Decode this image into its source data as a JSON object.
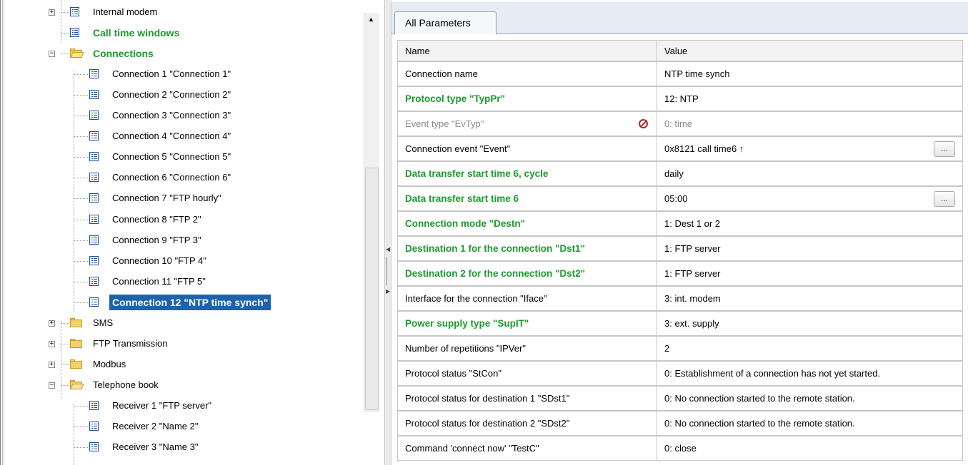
{
  "tree": {
    "items": [
      {
        "label": "Internal modem",
        "style": "normal",
        "icon": "list-icon",
        "expander": "+"
      },
      {
        "label": "Call time windows",
        "style": "green",
        "icon": "list-icon",
        "expander": ""
      },
      {
        "label": "Connections",
        "style": "green",
        "icon": "folder-open-icon",
        "expander": "−"
      },
      {
        "label": "Connection 1 \"Connection 1\"",
        "style": "normal",
        "icon": "list-icon"
      },
      {
        "label": "Connection 2 \"Connection 2\"",
        "style": "normal",
        "icon": "list-icon"
      },
      {
        "label": "Connection 3 \"Connection 3\"",
        "style": "normal",
        "icon": "list-icon"
      },
      {
        "label": "Connection 4 \"Connection 4\"",
        "style": "normal",
        "icon": "list-icon"
      },
      {
        "label": "Connection 5 \"Connection 5\"",
        "style": "normal",
        "icon": "list-icon"
      },
      {
        "label": "Connection 6 \"Connection 6\"",
        "style": "normal",
        "icon": "list-icon"
      },
      {
        "label": "Connection 7 \"FTP hourly\"",
        "style": "normal",
        "icon": "list-icon"
      },
      {
        "label": "Connection 8 \"FTP 2\"",
        "style": "normal",
        "icon": "list-icon"
      },
      {
        "label": "Connection 9 \"FTP 3\"",
        "style": "normal",
        "icon": "list-icon"
      },
      {
        "label": "Connection 10 \"FTP 4\"",
        "style": "normal",
        "icon": "list-icon"
      },
      {
        "label": "Connection 11 \"FTP 5\"",
        "style": "normal",
        "icon": "list-icon"
      },
      {
        "label": "Connection 12 \"NTP time synch\"",
        "style": "selected",
        "icon": "list-icon"
      },
      {
        "label": "SMS",
        "style": "normal",
        "icon": "folder-icon",
        "expander": "+"
      },
      {
        "label": "FTP Transmission",
        "style": "normal",
        "icon": "folder-icon",
        "expander": "+"
      },
      {
        "label": "Modbus",
        "style": "normal",
        "icon": "folder-icon",
        "expander": "+"
      },
      {
        "label": "Telephone book",
        "style": "normal",
        "icon": "folder-open-icon",
        "expander": "−"
      },
      {
        "label": "Receiver 1 \"FTP server\"",
        "style": "normal",
        "icon": "list-icon"
      },
      {
        "label": "Receiver 2 \"Name 2\"",
        "style": "normal",
        "icon": "list-icon"
      },
      {
        "label": "Receiver 3 \"Name 3\"",
        "style": "normal",
        "icon": "list-icon"
      }
    ]
  },
  "tabs": [
    {
      "label": "All Parameters",
      "active": true
    }
  ],
  "grid": {
    "columns": [
      "Name",
      "Value"
    ],
    "rows": [
      {
        "name": "Connection name",
        "value": "NTP time synch",
        "style": "normal"
      },
      {
        "name": "Protocol type \"TypPr\"",
        "value": "12: NTP",
        "style": "green"
      },
      {
        "name": "Event type \"EvTyp\"",
        "value": "0: time",
        "style": "grey",
        "name_icon": "no-entry-icon"
      },
      {
        "name": "Connection event \"Event\"",
        "value": "0x8121 call time6 ↑",
        "style": "normal",
        "button": "..."
      },
      {
        "name": "Data transfer start time 6, cycle",
        "value": "daily",
        "style": "green"
      },
      {
        "name": "Data transfer start time 6",
        "value": "05:00",
        "style": "green",
        "button": "..."
      },
      {
        "name": "Connection mode \"Destn\"",
        "value": "1: Dest 1 or 2",
        "style": "green"
      },
      {
        "name": "Destination 1 for the connection \"Dst1\"",
        "value": "1: FTP server",
        "style": "green"
      },
      {
        "name": "Destination 2 for the connection \"Dst2\"",
        "value": "1: FTP server",
        "style": "green"
      },
      {
        "name": "Interface for the connection \"Iface\"",
        "value": "3: int. modem",
        "style": "normal"
      },
      {
        "name": "Power supply type \"SupIT\"",
        "value": "3: ext. supply",
        "style": "green"
      },
      {
        "name": "Number of repetitions \"IPVer\"",
        "value": "2",
        "style": "normal"
      },
      {
        "name": "Protocol status \"StCon\"",
        "value": "0: Establishment of a connection has not yet started.",
        "style": "normal"
      },
      {
        "name": "Protocol status for destination 1 \"SDst1\"",
        "value": "0: No connection started to the remote station.",
        "style": "normal"
      },
      {
        "name": "Protocol status for destination 2 \"SDst2\"",
        "value": "0: No connection started to the remote station.",
        "style": "normal"
      },
      {
        "name": "Command 'connect now' \"TestC\"",
        "value": "0: close",
        "style": "normal"
      }
    ]
  },
  "colors": {
    "green": "#1c9a2e",
    "selection": "#1e62ad",
    "grid_border": "#c7c7c7"
  }
}
